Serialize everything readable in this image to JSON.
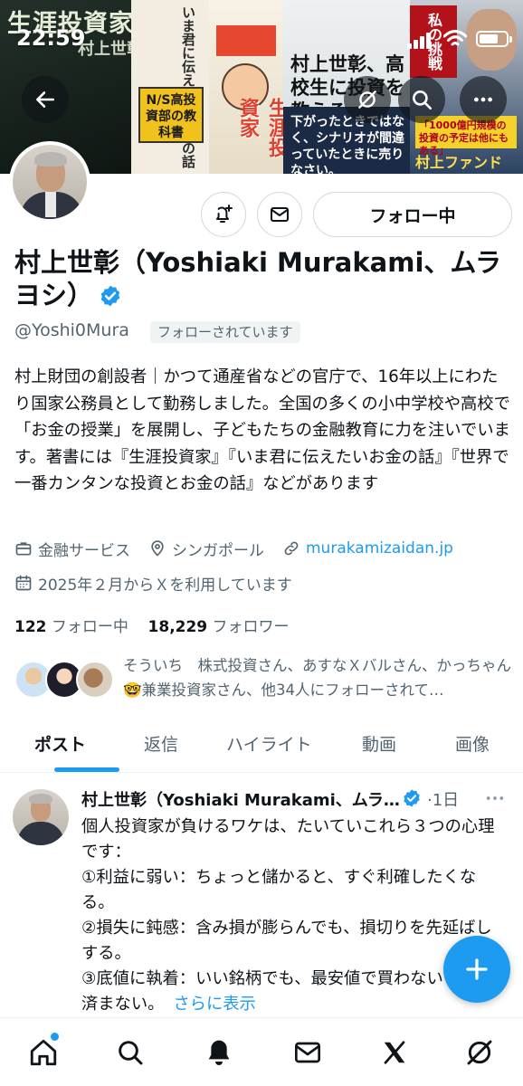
{
  "status_bar": {
    "time": "22:59"
  },
  "banner": {
    "book1_title": "生涯投資家",
    "book1_author": "村上世彰",
    "book2_title": "いま君に伝えたいお金の話",
    "book2_sub": "N/S高投資部の教科書",
    "book3_title": "生涯投資家",
    "book4_title": "村上世彰、高校生に投資を教える。",
    "book4_sub": "下がったときではなく、シナリオが間違っていたときに売りなさい。",
    "book5_title": "私の挑戦",
    "book5_sub": "「1000億円規模の投資の予定は他にもある」",
    "book5_brand": "村上ファンド"
  },
  "profile": {
    "name": "村上世彰（Yoshiaki Murakami、ムラヨシ）",
    "handle": "@Yoshi0Mura",
    "follows_you": "フォローされています",
    "follow_button": "フォロー中",
    "bio": "村上財団の創設者｜かつて通産省などの官庁で、16年以上にわたり国家公務員として勤務しました。全国の多くの小中学校や高校で「お金の授業」を展開し、子どもたちの金融教育に力を注いでいます。著書には『生涯投資家』『いま君に伝えたいお金の話』『世界で一番カンタンな投資とお金の話』などがあります",
    "category": "金融サービス",
    "location": "シンガポール",
    "website": "murakamizaidan.jp",
    "joined": "2025年２月からＸを利用しています",
    "following_count": "122",
    "following_label": "フォロー中",
    "followers_count": "18,229",
    "followers_label": "フォロワー",
    "followed_by": "そういち　株式投資さん、あすなＸバルさん、かっちゃん🤓兼業投資家さん、他34人にフォローされて…"
  },
  "tabs": [
    "ポスト",
    "返信",
    "ハイライト",
    "動画",
    "画像"
  ],
  "post": {
    "author": "村上世彰（Yoshiaki Murakami、ムラヨシ）",
    "time": "·1日",
    "line1": "個人投資家が負けるワケは、たいていこれら３つの心理です：",
    "line2": "①利益に弱い：ちょっと儲かると、すぐ利確したくなる。",
    "line3": "②損失に鈍感：含み損が膨らんでも、損切りを先延ばしする。",
    "line4": "③底値に執着：いい銘柄でも、最安値で買わないと気が済まない。",
    "show_more": "さらに表示"
  },
  "colors": {
    "accent": "#1d9bf0",
    "text": "#0f1419",
    "muted": "#536471",
    "border": "#cfd9de"
  },
  "icons": {
    "nav": [
      "home-icon",
      "search-icon",
      "notifications-icon",
      "messages-icon",
      "x-logo-icon",
      "grok-icon"
    ],
    "header": [
      "back-arrow-icon",
      "grok-icon",
      "search-icon",
      "more-icon"
    ]
  }
}
